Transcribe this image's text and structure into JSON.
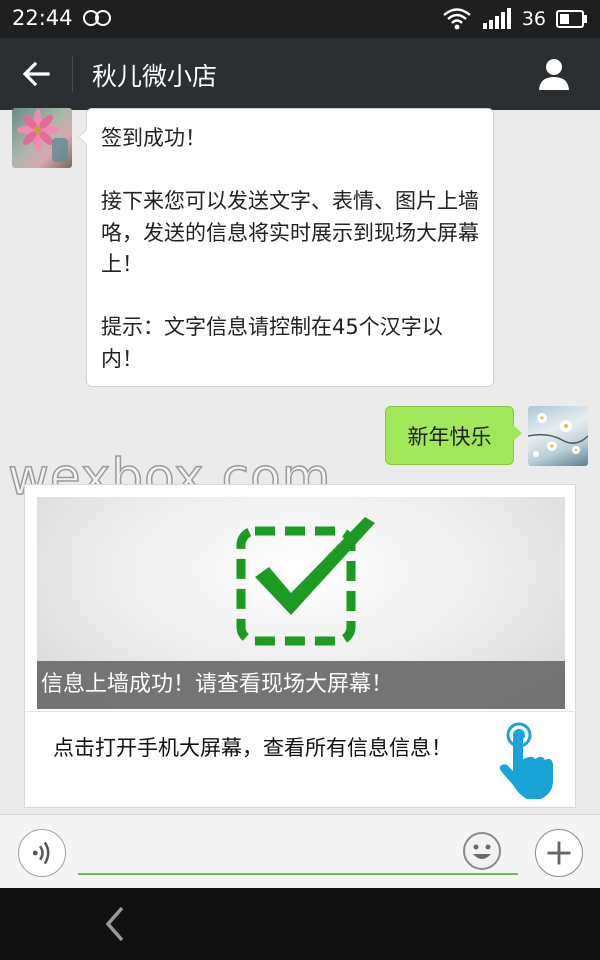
{
  "status_bar": {
    "time": "22:44",
    "signal_level": "36"
  },
  "header": {
    "title": "秋儿微小店"
  },
  "messages": {
    "incoming": {
      "line1": "签到成功！",
      "line2": "接下来您可以发送文字、表情、图片上墙咯，发送的信息将实时展示到现场大屏幕上！",
      "line3": "提示：文字信息请控制在45个汉字以内！"
    },
    "outgoing": {
      "text": "新年快乐"
    },
    "card": {
      "caption": "信息上墙成功！请查看现场大屏幕！",
      "link_text": "点击打开手机大屏幕，查看所有信息信息！"
    }
  },
  "watermark": "wexbox.com",
  "input": {
    "placeholder": "",
    "value": ""
  },
  "colors": {
    "status_bar_bg": "#1f1f1f",
    "nav_bg": "#2b2f32",
    "outgoing_bubble": "#a0e75a",
    "check_green": "#1b9b22",
    "hand_blue": "#1aa3d6",
    "input_underline": "#77b84c"
  },
  "icons": {
    "back": "arrow-left-icon",
    "profile": "person-icon",
    "infinity": "infinity-icon",
    "wifi": "wifi-icon",
    "signal": "signal-bars-icon",
    "battery": "battery-icon",
    "voice": "voice-icon",
    "emoji": "smiley-icon",
    "plus": "plus-icon",
    "check": "checkbox-check-icon",
    "hand": "tap-hand-icon",
    "system_back": "chevron-left-icon"
  }
}
